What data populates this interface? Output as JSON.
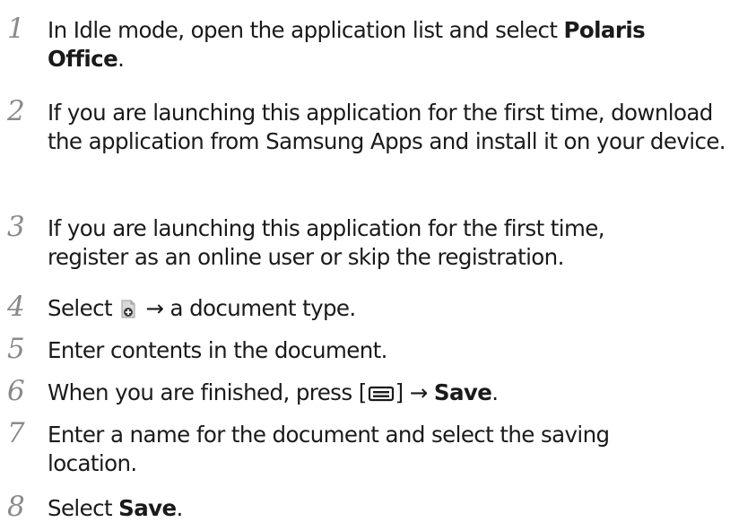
{
  "steps": [
    {
      "num": "1",
      "parts": [
        {
          "t": "In Idle mode, open the application list and select "
        },
        {
          "t": "Polaris Office",
          "b": true
        },
        {
          "t": "."
        }
      ]
    },
    {
      "num": "2",
      "parts": [
        {
          "t": "If you are launching this application for the first time, download the application from Samsung Apps and install it on your device."
        }
      ]
    },
    {
      "num": "3",
      "parts": [
        {
          "t": "If you are launching this application for the first time, register as an online user or skip the registration."
        }
      ]
    },
    {
      "num": "4",
      "parts": [
        {
          "t": "Select "
        },
        {
          "icon": "new-document-icon"
        },
        {
          "t": " → a document type."
        }
      ]
    },
    {
      "num": "5",
      "parts": [
        {
          "t": "Enter contents in the document."
        }
      ]
    },
    {
      "num": "6",
      "parts": [
        {
          "t": "When you are finished, press ["
        },
        {
          "icon": "menu-key-icon"
        },
        {
          "t": "] → "
        },
        {
          "t": "Save",
          "b": true
        },
        {
          "t": "."
        }
      ]
    },
    {
      "num": "7",
      "parts": [
        {
          "t": "Enter a name for the document and select the saving location."
        }
      ]
    },
    {
      "num": "8",
      "parts": [
        {
          "t": "Select "
        },
        {
          "t": "Save",
          "b": true
        },
        {
          "t": "."
        }
      ]
    }
  ]
}
